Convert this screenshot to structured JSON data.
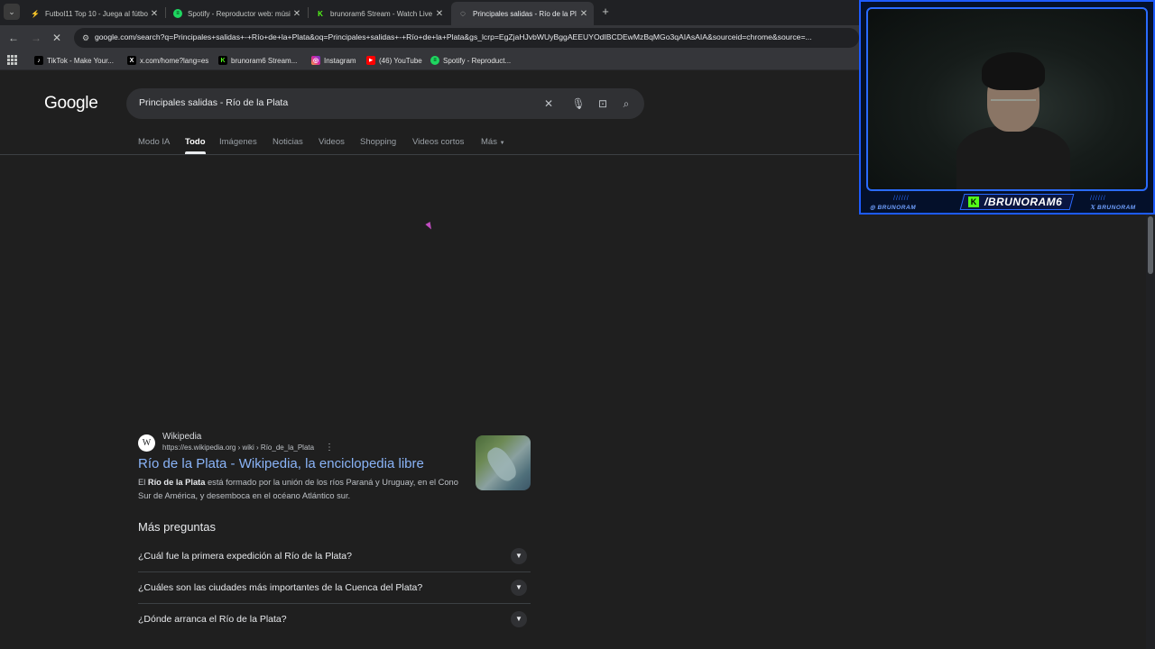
{
  "browser": {
    "tabs": [
      {
        "title": "Futbol11 Top 10 - Juega al fútbo",
        "favicon": "futbol11-icon",
        "active": false
      },
      {
        "title": "Spotify - Reproductor web: músi",
        "favicon": "spotify-icon",
        "active": false
      },
      {
        "title": "brunoram6 Stream - Watch Live",
        "favicon": "kick-icon",
        "active": false
      },
      {
        "title": "Principales salidas - Río de la Pl",
        "favicon": "loading-icon",
        "active": true
      }
    ],
    "tab_close_glyph": "✕",
    "new_tab_glyph": "+",
    "tab_list_glyph": "⌄",
    "address_bar": {
      "url": "google.com/search?q=Principales+salidas+-+Río+de+la+Plata&oq=Principales+salidas+-+Río+de+la+Plata&gs_lcrp=EgZjaHJvbWUyBggAEEUYOdIBCDEwMzBqMGo3qAIAsAIA&sourceid=chrome&source=..."
    },
    "bookmarks": [
      {
        "label": "TikTok - Make Your...",
        "icon": "tiktok-icon"
      },
      {
        "label": "x.com/home?lang=es",
        "icon": "x-icon"
      },
      {
        "label": "brunoram6 Stream...",
        "icon": "kick-icon"
      },
      {
        "label": "Instagram",
        "icon": "instagram-icon"
      },
      {
        "label": "(46) YouTube",
        "icon": "youtube-icon"
      },
      {
        "label": "Spotify - Reproduct...",
        "icon": "spotify-icon"
      }
    ]
  },
  "google": {
    "logo": "Google",
    "query": "Principales salidas - Río de la Plata",
    "tabs": [
      "Modo IA",
      "Todo",
      "Imágenes",
      "Noticias",
      "Videos",
      "Shopping",
      "Videos cortos",
      "Más"
    ],
    "active_tab": "Todo",
    "result": {
      "site_name": "Wikipedia",
      "favicon_letter": "W",
      "url": "https://es.wikipedia.org › wiki › Río_de_la_Plata",
      "title": "Río de la Plata - Wikipedia, la enciclopedia libre",
      "snippet_prefix": "El ",
      "snippet_bold": "Río de la Plata",
      "snippet_rest": " está formado por la unión de los ríos Paraná y Uruguay, en el Cono Sur de América, y desemboca en el océano Atlántico sur."
    },
    "people_also_ask": {
      "heading": "Más preguntas",
      "questions": [
        "¿Cuál fue la primera expedición al Río de la Plata?",
        "¿Cuáles son las ciudades más importantes de la Cuenca del Plata?",
        "¿Dónde arranca el Río de la Plata?"
      ]
    }
  },
  "webcam": {
    "handle": "/BRUNORAM6",
    "kick_letter": "K",
    "instagram_tag": "◎ BRUNORAM",
    "x_tag": "𝕏 BRUNORAM"
  },
  "colors": {
    "link": "#8ab4f8",
    "accent_blue": "#1d5bff",
    "kick_green": "#53fc18"
  }
}
